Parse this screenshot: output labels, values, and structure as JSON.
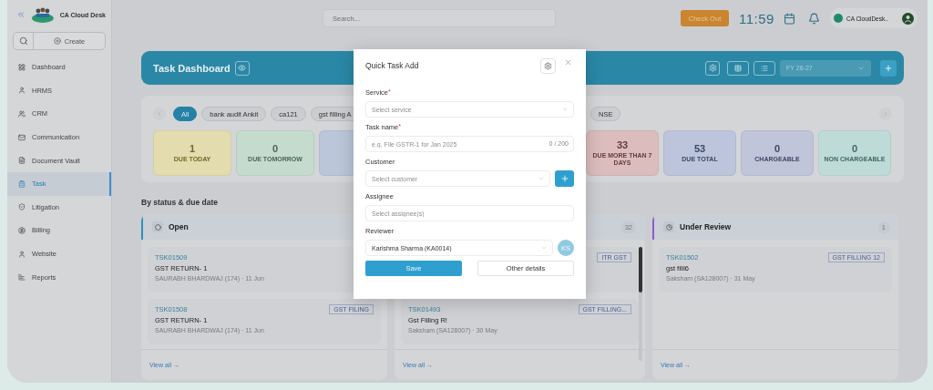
{
  "sidebar": {
    "brand": "CA Cloud Desk",
    "create_label": "Create",
    "items": [
      {
        "label": "Dashboard",
        "selected": false
      },
      {
        "label": "HRMS",
        "selected": false
      },
      {
        "label": "CRM",
        "selected": false
      },
      {
        "label": "Communication",
        "selected": false
      },
      {
        "label": "Document Vault",
        "selected": false
      },
      {
        "label": "Task",
        "selected": true
      },
      {
        "label": "Litigation",
        "selected": false
      },
      {
        "label": "Billing",
        "selected": false
      },
      {
        "label": "Website",
        "selected": false
      },
      {
        "label": "Reports",
        "selected": false
      }
    ]
  },
  "topbar": {
    "search_placeholder": "Search...",
    "checkout": "Check Out",
    "time": "11:59",
    "org": "CA CloudDesk.."
  },
  "dashboard": {
    "title": "Task Dashboard",
    "fy": "FY 26-27"
  },
  "filters": {
    "chips": [
      {
        "label": "All",
        "selected": true
      },
      {
        "label": "bank audit Ankit",
        "selected": false
      },
      {
        "label": "ca121",
        "selected": false
      },
      {
        "label": "gst filling A",
        "selected": false
      }
    ],
    "trailing_chip": {
      "label": "NSE",
      "selected": false
    }
  },
  "stats_left": [
    {
      "value": "1",
      "label": "DUE TODAY",
      "color": "#e3dcaf"
    },
    {
      "value": "0",
      "label": "DUE TOMORROW",
      "color": "#c5dbcd"
    },
    {
      "color": "#bcc6da"
    }
  ],
  "stats_right": [
    {
      "value": "33",
      "label": "DUE MORE THAN 7 DAYS",
      "color": "#dbbdbd"
    },
    {
      "value": "53",
      "label": "DUE TOTAL",
      "color": "#bcc5db"
    },
    {
      "value": "0",
      "label": "CHARGEABLE",
      "color": "#c1c5da"
    },
    {
      "value": "0",
      "label": "NON CHARGEABLE",
      "color": "#bfdbd7"
    }
  ],
  "section_title": "By status & due date",
  "columns": [
    {
      "kind": "open",
      "title": "Open",
      "cards": [
        {
          "id": "TSK01509",
          "title": "GST RETURN- 1",
          "meta": "SAURABH BHARDWAJ (174) · 11 Jun"
        },
        {
          "id": "TSK01508",
          "tag": "GST FILING",
          "title": "GST RETURN- 1",
          "meta": "SAURABH BHARDWAJ (174) · 11 Jun"
        }
      ],
      "view_all": "View all →"
    },
    {
      "kind": "progress",
      "count": "32",
      "cards": [
        {
          "tag": "ITR GST"
        },
        {
          "id": "TSK01493",
          "tag": "GST FILLING...",
          "title": "Gst Filling R!",
          "meta": "Saksham (SA128007) · 30 May"
        }
      ],
      "view_all": "View all →"
    },
    {
      "kind": "review",
      "title": "Under Review",
      "count": "1",
      "cards": [
        {
          "id": "TSK01502",
          "tag": "GST FILLING 12",
          "title": "gst filli6",
          "meta": "Saksham (SA128007) · 31 May"
        }
      ],
      "view_all": "View all →"
    }
  ],
  "modal": {
    "title": "Quick Task Add",
    "fields": [
      {
        "kind": "select",
        "label": "Service",
        "required_mark": "*",
        "placeholder": "Select service"
      },
      {
        "kind": "text",
        "label": "Task name",
        "required_mark": "*",
        "placeholder": "e.g. File GSTR-1 for Jan 2025",
        "counter": "0 / 200"
      },
      {
        "kind": "select_add",
        "label": "Customer",
        "placeholder": "Select customer"
      },
      {
        "kind": "multi",
        "label": "Assignee",
        "placeholder": "Select assignee(s)"
      },
      {
        "kind": "select_avatar",
        "label": "Reviewer",
        "value": "Karishma Sharma (KA0014)",
        "avatar": "KS"
      }
    ],
    "save": "Save",
    "other": "Other details"
  }
}
